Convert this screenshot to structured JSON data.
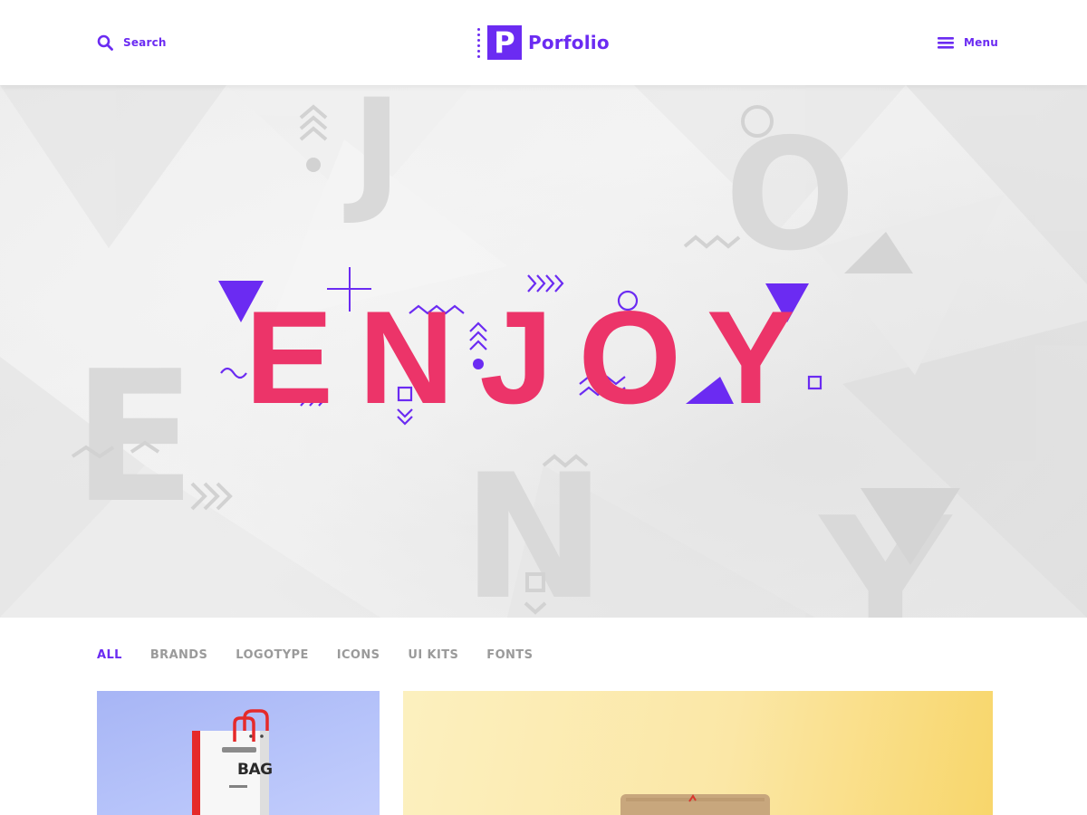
{
  "header": {
    "search_label": "Search",
    "search_icon": "search-icon",
    "brand_letter": "P",
    "brand_name": "Porfolio",
    "menu_label": "Menu",
    "menu_icon": "hamburger-icon"
  },
  "hero": {
    "headline": "ENJOY",
    "background_letters": [
      "J",
      "O",
      "E",
      "N",
      "Y"
    ]
  },
  "filters": {
    "tabs": [
      "ALL",
      "BRANDS",
      "LOGOTYPE",
      "ICONS",
      "UI KITS",
      "FONTS"
    ],
    "active": "ALL"
  },
  "portfolio": {
    "items": [
      {
        "bag_text": "BAG"
      },
      {}
    ]
  },
  "colors": {
    "accent_purple": "#6b2bf2",
    "headline_pink": "#ec3469",
    "inactive_tab": "#9a9a9a",
    "hero_background": "#ececec",
    "bag_card": "#b2c0fa",
    "yellow_card": "#fbe7a6"
  }
}
